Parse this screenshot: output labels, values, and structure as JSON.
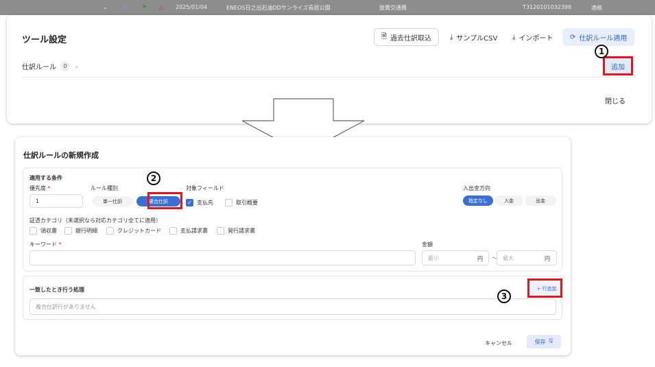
{
  "background_row": {
    "date": "2025/01/04",
    "vendor": "ENEOS日之出石油DDサンライズ長居公園",
    "account": "旅費交通費",
    "number": "T3120101032398",
    "status": "適格"
  },
  "tool_dialog": {
    "title": "ツール設定",
    "buttons": {
      "past_import": "過去仕訳取込",
      "sample_csv": "サンプルCSV",
      "import": "インポート",
      "apply_rules": "仕訳ルール適用"
    },
    "rule_label": "仕訳ルール",
    "rule_count": "0",
    "add_label": "追加",
    "close_label": "閉じる"
  },
  "annotations": {
    "n1": "1",
    "n2": "2",
    "n3": "3"
  },
  "new_rule_dialog": {
    "title": "仕訳ルールの新規作成",
    "conditions_heading": "適用する条件",
    "priority_label": "優先度",
    "required_mark": "*",
    "priority_value": "1",
    "rule_type_label": "ルール種別",
    "rule_type_options": [
      "単一仕訳",
      "複合仕訳"
    ],
    "rule_type_selected": "複合仕訳",
    "target_field_label": "対象フィールド",
    "target_fields": [
      "支払先",
      "取引概要"
    ],
    "direction_label": "入出金方向",
    "direction_options": [
      "指定なし",
      "入金",
      "出金"
    ],
    "direction_selected": "指定なし",
    "category_label": "証憑カテゴリ（未選択なら対応カテゴリ全てに適用）",
    "categories": [
      "領収書",
      "銀行明細",
      "クレジットカード",
      "支払請求書",
      "発行請求書"
    ],
    "keyword_label": "キーワード",
    "amount_label": "金額",
    "amount_min_placeholder": "最小",
    "amount_max_placeholder": "最大",
    "amount_unit": "円",
    "amount_sep": "〜",
    "match_action_label": "一致したとき行う処理",
    "add_row_label": "+ 行追加",
    "empty_message": "複合仕訳行がありません",
    "cancel_label": "キャンセル",
    "save_label": "保存"
  },
  "colors": {
    "accent": "#3b6fd8",
    "highlight": "#e5141b"
  }
}
